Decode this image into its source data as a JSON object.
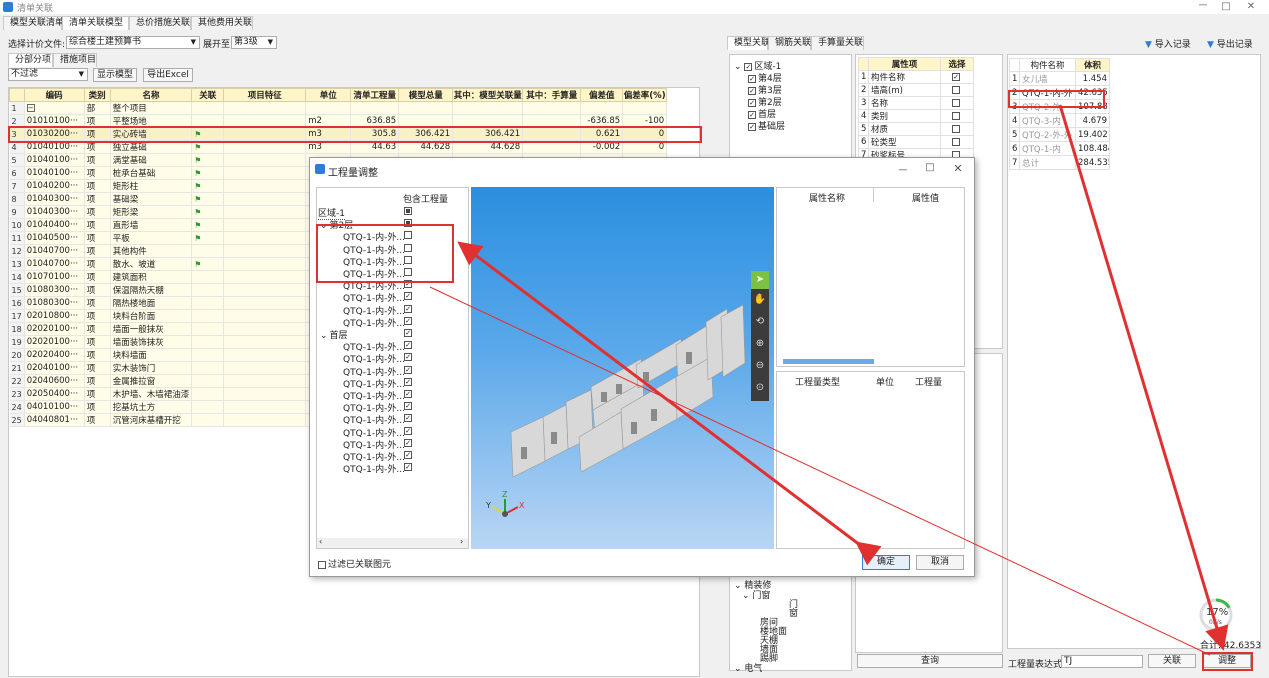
{
  "app": {
    "title": "清单关联",
    "window_buttons": [
      "ㅡ",
      "□",
      "✕"
    ]
  },
  "main_tabs": [
    "模型关联清单",
    "清单关联模型",
    "总价措施关联",
    "其他费用关联"
  ],
  "toolbar": {
    "select_file_label": "选择计价文件:",
    "select_file_value": "综合楼土建预算书",
    "expand_label": "展开至",
    "expand_value": "第3级"
  },
  "sub_tabs": [
    "分部分项",
    "措施项目"
  ],
  "filter": {
    "value": "不过滤",
    "show_model_button": "显示模型",
    "export_excel_button": "导出Excel"
  },
  "grid": {
    "columns": [
      "编码",
      "类别",
      "名称",
      "关联",
      "项目特征",
      "单位",
      "清单工程量",
      "模型总量",
      "其中：模型关联量",
      "其中：手算量",
      "偏差值",
      "偏差率(%)"
    ],
    "rows": [
      [
        "1",
        "",
        "部",
        "整个项目",
        "",
        "",
        "",
        "",
        "",
        "",
        "",
        "",
        ""
      ],
      [
        "2",
        "01010100···",
        "项",
        "平整场地",
        "",
        "",
        "m2",
        "636.85",
        "",
        "",
        "",
        "-636.85",
        "-100"
      ],
      [
        "3",
        "01030200···",
        "项",
        "实心砖墙",
        "⚑",
        "",
        "m3",
        "305.8",
        "306.421",
        "306.421",
        "",
        "0.621",
        "0"
      ],
      [
        "4",
        "01040100···",
        "项",
        "独立基础",
        "⚑",
        "",
        "m3",
        "44.63",
        "44.628",
        "44.628",
        "",
        "-0.002",
        "0"
      ],
      [
        "5",
        "01040100···",
        "项",
        "满堂基础",
        "⚑",
        "",
        "",
        "",
        "",
        "",
        "",
        "",
        ""
      ],
      [
        "6",
        "01040100···",
        "项",
        "桩承台基础",
        "⚑",
        "",
        "",
        "",
        "",
        "",
        "",
        "",
        ""
      ],
      [
        "7",
        "01040200···",
        "项",
        "矩形柱",
        "⚑",
        "",
        "",
        "",
        "",
        "",
        "",
        "",
        ""
      ],
      [
        "8",
        "01040300···",
        "项",
        "基础梁",
        "⚑",
        "",
        "",
        "",
        "",
        "",
        "",
        "",
        ""
      ],
      [
        "9",
        "01040300···",
        "项",
        "矩形梁",
        "⚑",
        "",
        "",
        "",
        "",
        "",
        "",
        "",
        ""
      ],
      [
        "10",
        "01040400···",
        "项",
        "直形墙",
        "⚑",
        "",
        "",
        "",
        "",
        "",
        "",
        "",
        ""
      ],
      [
        "11",
        "01040500···",
        "项",
        "平板",
        "⚑",
        "",
        "",
        "",
        "",
        "",
        "",
        "",
        ""
      ],
      [
        "12",
        "01040700···",
        "项",
        "其他构件",
        "",
        "",
        "",
        "",
        "",
        "",
        "",
        "",
        ""
      ],
      [
        "13",
        "01040700···",
        "项",
        "散水、坡道",
        "⚑",
        "",
        "",
        "",
        "",
        "",
        "",
        "",
        ""
      ],
      [
        "14",
        "01070100···",
        "项",
        "建筑面积",
        "",
        "",
        "",
        "",
        "",
        "",
        "",
        "",
        ""
      ],
      [
        "15",
        "01080300···",
        "项",
        "保温隔热天棚",
        "",
        "",
        "",
        "",
        "",
        "",
        "",
        "",
        ""
      ],
      [
        "16",
        "01080300···",
        "项",
        "隔热楼地面",
        "",
        "",
        "",
        "",
        "",
        "",
        "",
        "",
        ""
      ],
      [
        "17",
        "02010800···",
        "项",
        "块料台阶面",
        "",
        "",
        "",
        "",
        "",
        "",
        "",
        "",
        ""
      ],
      [
        "18",
        "02020100···",
        "项",
        "墙面一般抹灰",
        "",
        "",
        "",
        "",
        "",
        "",
        "",
        "",
        ""
      ],
      [
        "19",
        "02020100···",
        "项",
        "墙面装饰抹灰",
        "",
        "",
        "",
        "",
        "",
        "",
        "",
        "",
        ""
      ],
      [
        "20",
        "02020400···",
        "项",
        "块料墙面",
        "",
        "",
        "",
        "",
        "",
        "",
        "",
        "",
        ""
      ],
      [
        "21",
        "02040100···",
        "项",
        "实木装饰门",
        "",
        "",
        "",
        "",
        "",
        "",
        "",
        "",
        ""
      ],
      [
        "22",
        "02040600···",
        "项",
        "金属推拉窗",
        "",
        "",
        "",
        "",
        "",
        "",
        "",
        "",
        ""
      ],
      [
        "23",
        "02050400···",
        "项",
        "木护墙、木墙裙油漆",
        "",
        "",
        "",
        "",
        "",
        "",
        "",
        "",
        ""
      ],
      [
        "24",
        "04010100···",
        "项",
        "挖基坑土方",
        "",
        "",
        "",
        "",
        "",
        "",
        "",
        "",
        ""
      ],
      [
        "25",
        "04040801···",
        "项",
        "沉管河床基槽开挖",
        "",
        "",
        "",
        "",
        "",
        "",
        "",
        "",
        ""
      ]
    ]
  },
  "right_tabs": [
    "模型关联",
    "钢筋关联",
    "手算量关联"
  ],
  "right_actions": {
    "import_records": "导入记录",
    "export_records": "导出记录"
  },
  "region_tree": {
    "root": "区域-1",
    "floors": [
      "第4层",
      "第3层",
      "第2层",
      "首层",
      "基础层"
    ]
  },
  "property_table": {
    "headers": [
      "属性项",
      "选择"
    ],
    "rows": [
      {
        "n": "1",
        "name": "构件名称",
        "checked": true
      },
      {
        "n": "2",
        "name": "墙高(m)",
        "checked": false
      },
      {
        "n": "3",
        "name": "名称",
        "checked": false
      },
      {
        "n": "4",
        "name": "类别",
        "checked": false
      },
      {
        "n": "5",
        "name": "材质",
        "checked": false
      },
      {
        "n": "6",
        "name": "砼类型",
        "checked": false
      },
      {
        "n": "7",
        "name": "砂浆标号",
        "checked": false
      }
    ]
  },
  "component_table": {
    "headers": [
      "构件名称",
      "体积"
    ],
    "rows": [
      [
        "1",
        "女儿墙",
        "1.454"
      ],
      [
        "2",
        "QTQ-1-内-外",
        "42.635"
      ],
      [
        "3",
        "QTQ-2-外",
        "107.881"
      ],
      [
        "4",
        "QTQ-3-内",
        "4.679"
      ],
      [
        "5",
        "QTQ-2-外-外",
        "19.402"
      ],
      [
        "6",
        "QTQ-1-内",
        "108.484"
      ],
      [
        "7",
        "总计",
        "284.535"
      ]
    ]
  },
  "left_lower_tree": [
    "精装修",
    "门窗",
    "门",
    "窗",
    "房间",
    "楼地面",
    "天棚",
    "墙面",
    "踢脚",
    "电气"
  ],
  "bottom": {
    "query_button": "查询",
    "expr_label": "工程量表达式:",
    "expr_value": "TJ",
    "link_button": "关联",
    "adjust_button": "调整",
    "total_label": "合计: 42.6353"
  },
  "progress": {
    "percent": 17,
    "percent_label": "17%",
    "speed": "0K/s"
  },
  "dialog": {
    "title": "工程量调整",
    "window_buttons": [
      "ㅡ",
      "□",
      "✕"
    ],
    "tree_headers": [
      "",
      "包含工程量"
    ],
    "tree_rows": [
      {
        "label": "区域-1",
        "indent": 0,
        "state": "partial"
      },
      {
        "label": "第2层",
        "indent": 1,
        "state": "partial",
        "expander": "⌄"
      },
      {
        "label": "QTQ-1-内-外...",
        "indent": 2,
        "state": "unchecked"
      },
      {
        "label": "QTQ-1-内-外...",
        "indent": 2,
        "state": "unchecked"
      },
      {
        "label": "QTQ-1-内-外...",
        "indent": 2,
        "state": "unchecked"
      },
      {
        "label": "QTQ-1-内-外...",
        "indent": 2,
        "state": "unchecked"
      },
      {
        "label": "QTQ-1-内-外...",
        "indent": 2,
        "state": "checked"
      },
      {
        "label": "QTQ-1-内-外...",
        "indent": 2,
        "state": "checked"
      },
      {
        "label": "QTQ-1-内-外...",
        "indent": 2,
        "state": "checked"
      },
      {
        "label": "QTQ-1-内-外...",
        "indent": 2,
        "state": "checked"
      },
      {
        "label": "首层",
        "indent": 1,
        "state": "checked",
        "expander": "⌄"
      },
      {
        "label": "QTQ-1-内-外...",
        "indent": 2,
        "state": "checked"
      },
      {
        "label": "QTQ-1-内-外...",
        "indent": 2,
        "state": "checked"
      },
      {
        "label": "QTQ-1-内-外...",
        "indent": 2,
        "state": "checked"
      },
      {
        "label": "QTQ-1-内-外...",
        "indent": 2,
        "state": "checked"
      },
      {
        "label": "QTQ-1-内-外...",
        "indent": 2,
        "state": "checked"
      },
      {
        "label": "QTQ-1-内-外...",
        "indent": 2,
        "state": "checked"
      },
      {
        "label": "QTQ-1-内-外...",
        "indent": 2,
        "state": "checked"
      },
      {
        "label": "QTQ-1-内-外...",
        "indent": 2,
        "state": "checked"
      },
      {
        "label": "QTQ-1-内-外...",
        "indent": 2,
        "state": "checked"
      },
      {
        "label": "QTQ-1-内-外...",
        "indent": 2,
        "state": "checked"
      },
      {
        "label": "QTQ-1-内-外...",
        "indent": 2,
        "state": "checked"
      }
    ],
    "props_headers": [
      "属性名称",
      "属性值"
    ],
    "qty_headers": [
      "工程量类型",
      "单位",
      "工程量"
    ],
    "filter_label": "过滤已关联图元",
    "ok_button": "确定",
    "cancel_button": "取消",
    "axis_labels": [
      "X",
      "Y",
      "Z"
    ]
  },
  "colors": {
    "highlight_red": "#e03030",
    "header_yellow": "#fff5c8",
    "flag_green": "#2c9b35",
    "accent_blue": "#2d7cd6"
  }
}
